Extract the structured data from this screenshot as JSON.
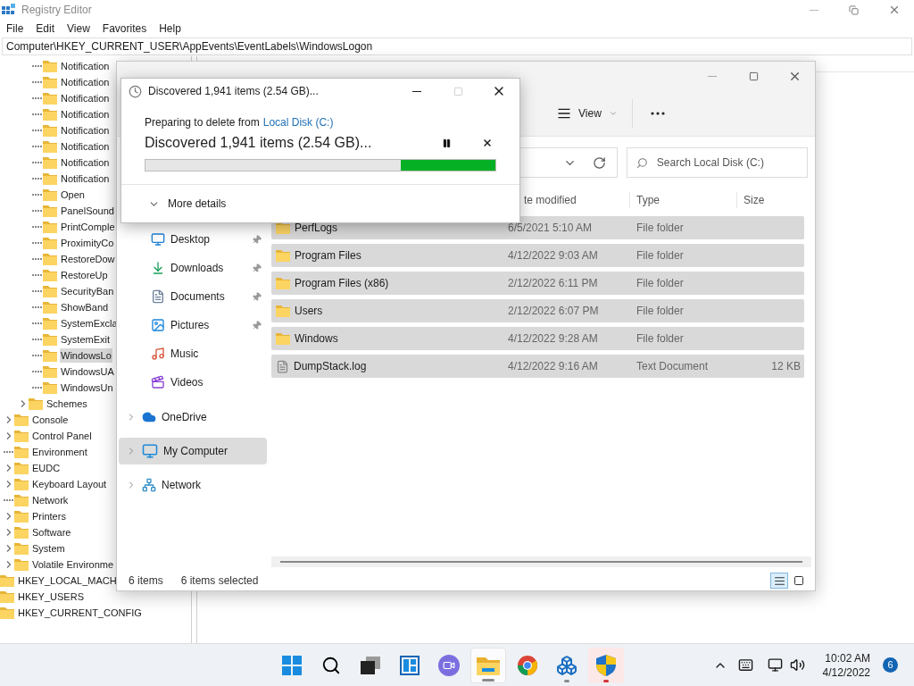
{
  "registry": {
    "title": "Registry Editor",
    "menu": [
      "File",
      "Edit",
      "View",
      "Favorites",
      "Help"
    ],
    "address": "Computer\\HKEY_CURRENT_USER\\AppEvents\\EventLabels\\WindowsLogon",
    "tree": [
      {
        "children": [
          {
            "children": [
              {
                "children": [
                  {
                    "label": "Notification",
                    "expandable": false,
                    "selected": false
                  },
                  {
                    "label": "Notification",
                    "expandable": false,
                    "selected": false
                  },
                  {
                    "label": "Notification",
                    "expandable": false,
                    "selected": false
                  },
                  {
                    "label": "Notification",
                    "expandable": false,
                    "selected": false
                  },
                  {
                    "label": "Notification",
                    "expandable": false,
                    "selected": false
                  },
                  {
                    "label": "Notification",
                    "expandable": false,
                    "selected": false
                  },
                  {
                    "label": "Notification",
                    "expandable": false,
                    "selected": false
                  },
                  {
                    "label": "Notification",
                    "expandable": false,
                    "selected": false
                  },
                  {
                    "label": "Open",
                    "expandable": false,
                    "selected": false
                  },
                  {
                    "label": "PanelSound",
                    "expandable": false,
                    "selected": false
                  },
                  {
                    "label": "PrintComple",
                    "expandable": false,
                    "selected": false
                  },
                  {
                    "label": "ProximityCo",
                    "expandable": false,
                    "selected": false
                  },
                  {
                    "label": "RestoreDow",
                    "expandable": false,
                    "selected": false
                  },
                  {
                    "label": "RestoreUp",
                    "expandable": false,
                    "selected": false
                  },
                  {
                    "label": "SecurityBan",
                    "expandable": false,
                    "selected": false
                  },
                  {
                    "label": "ShowBand",
                    "expandable": false,
                    "selected": false
                  },
                  {
                    "label": "SystemExcla",
                    "expandable": false,
                    "selected": false
                  },
                  {
                    "label": "SystemExit",
                    "expandable": false,
                    "selected": false
                  },
                  {
                    "label": "WindowsLo",
                    "expandable": false,
                    "selected": true
                  },
                  {
                    "label": "WindowsUA",
                    "expandable": false,
                    "selected": false
                  },
                  {
                    "label": "WindowsUn",
                    "expandable": false,
                    "selected": false
                  }
                ]
              },
              {
                "label": "Schemes",
                "expandable": true,
                "selected": false
              }
            ]
          },
          {
            "label": "Console",
            "expandable": true,
            "selected": false
          },
          {
            "label": "Control Panel",
            "expandable": true,
            "selected": false
          },
          {
            "label": "Environment",
            "expandable": false,
            "selected": false
          },
          {
            "label": "EUDC",
            "expandable": true,
            "selected": false
          },
          {
            "label": "Keyboard Layout",
            "expandable": true,
            "selected": false
          },
          {
            "label": "Network",
            "expandable": false,
            "selected": false
          },
          {
            "label": "Printers",
            "expandable": true,
            "selected": false
          },
          {
            "label": "Software",
            "expandable": true,
            "selected": false
          },
          {
            "label": "System",
            "expandable": true,
            "selected": false
          },
          {
            "label": "Volatile Environme",
            "expandable": true,
            "selected": false
          }
        ]
      },
      {
        "label": "HKEY_LOCAL_MACH",
        "selected": false
      },
      {
        "label": "HKEY_USERS",
        "selected": false
      },
      {
        "label": "HKEY_CURRENT_CONFIG",
        "selected": false
      }
    ]
  },
  "explorer": {
    "toolbar": [
      {
        "kind": "view",
        "label": "View"
      },
      {
        "kind": "more"
      }
    ],
    "search": {
      "placeholder": "Search Local Disk (C:)"
    },
    "columns": [
      "te modified",
      "Type",
      "Size"
    ],
    "rows": [
      {
        "kind": "folder",
        "name": "PerfLogs",
        "modified": "6/5/2021 5:10 AM",
        "type": "File folder",
        "selected": true
      },
      {
        "kind": "folder",
        "name": "Program Files",
        "modified": "4/12/2022 9:03 AM",
        "type": "File folder",
        "selected": true
      },
      {
        "kind": "folder",
        "name": "Program Files (x86)",
        "modified": "2/12/2022 6:11 PM",
        "type": "File folder",
        "selected": true
      },
      {
        "kind": "folder",
        "name": "Users",
        "modified": "2/12/2022 6:07 PM",
        "type": "File folder",
        "selected": true
      },
      {
        "kind": "folder",
        "name": "Windows",
        "modified": "4/12/2022 9:28 AM",
        "type": "File folder",
        "selected": true
      },
      {
        "kind": "file",
        "name": "DumpStack.log",
        "modified": "4/12/2022 9:16 AM",
        "type": "Text Document",
        "size": "12 KB",
        "selected": true
      }
    ],
    "quick_access": [
      {
        "kind": "desktop",
        "label": "Desktop",
        "pinned": true,
        "selected": false
      },
      {
        "kind": "downloads",
        "label": "Downloads",
        "pinned": true,
        "selected": false
      },
      {
        "kind": "documents",
        "label": "Documents",
        "pinned": true,
        "selected": false
      },
      {
        "kind": "pictures",
        "label": "Pictures",
        "pinned": true,
        "selected": false
      },
      {
        "kind": "music",
        "label": "Music",
        "pinned": false,
        "selected": false
      },
      {
        "kind": "videos",
        "label": "Videos",
        "pinned": false,
        "selected": false
      }
    ],
    "locations": [
      {
        "kind": "onedrive",
        "label": "OneDrive",
        "selected": false
      },
      {
        "kind": "computer",
        "label": "My Computer",
        "selected": true
      },
      {
        "kind": "network",
        "label": "Network",
        "selected": false
      }
    ],
    "status": {
      "count": "6 items",
      "selection": "6 items selected"
    },
    "view_modes": [
      {
        "kind": "details",
        "selected": true
      },
      {
        "kind": "tiles",
        "selected": false
      }
    ]
  },
  "dialog": {
    "title": "Discovered 1,941 items (2.54 GB)...",
    "source_prefix": "Preparing to delete from",
    "source_link": "Local Disk (C:)",
    "status": "Discovered 1,941 items (2.54 GB)...",
    "level": 0.27,
    "details_toggle": "More details"
  },
  "taskbar": {
    "apps": [
      {
        "kind": "start",
        "running": false,
        "active": false,
        "alert": false
      },
      {
        "kind": "search",
        "running": false,
        "active": false,
        "alert": false
      },
      {
        "kind": "taskview",
        "running": false,
        "active": false,
        "alert": false
      },
      {
        "kind": "widgets",
        "running": false,
        "active": false,
        "alert": false
      },
      {
        "kind": "chat",
        "running": false,
        "active": false,
        "alert": false
      },
      {
        "kind": "explorer",
        "running": true,
        "active": true,
        "alert": false
      },
      {
        "kind": "chrome",
        "running": false,
        "active": false,
        "alert": false
      },
      {
        "kind": "cubes",
        "running": true,
        "active": false,
        "alert": false
      },
      {
        "kind": "shield",
        "running": true,
        "active": false,
        "alert": true
      }
    ],
    "time": "10:02 AM",
    "date": "4/12/2022",
    "notifications": "6"
  }
}
